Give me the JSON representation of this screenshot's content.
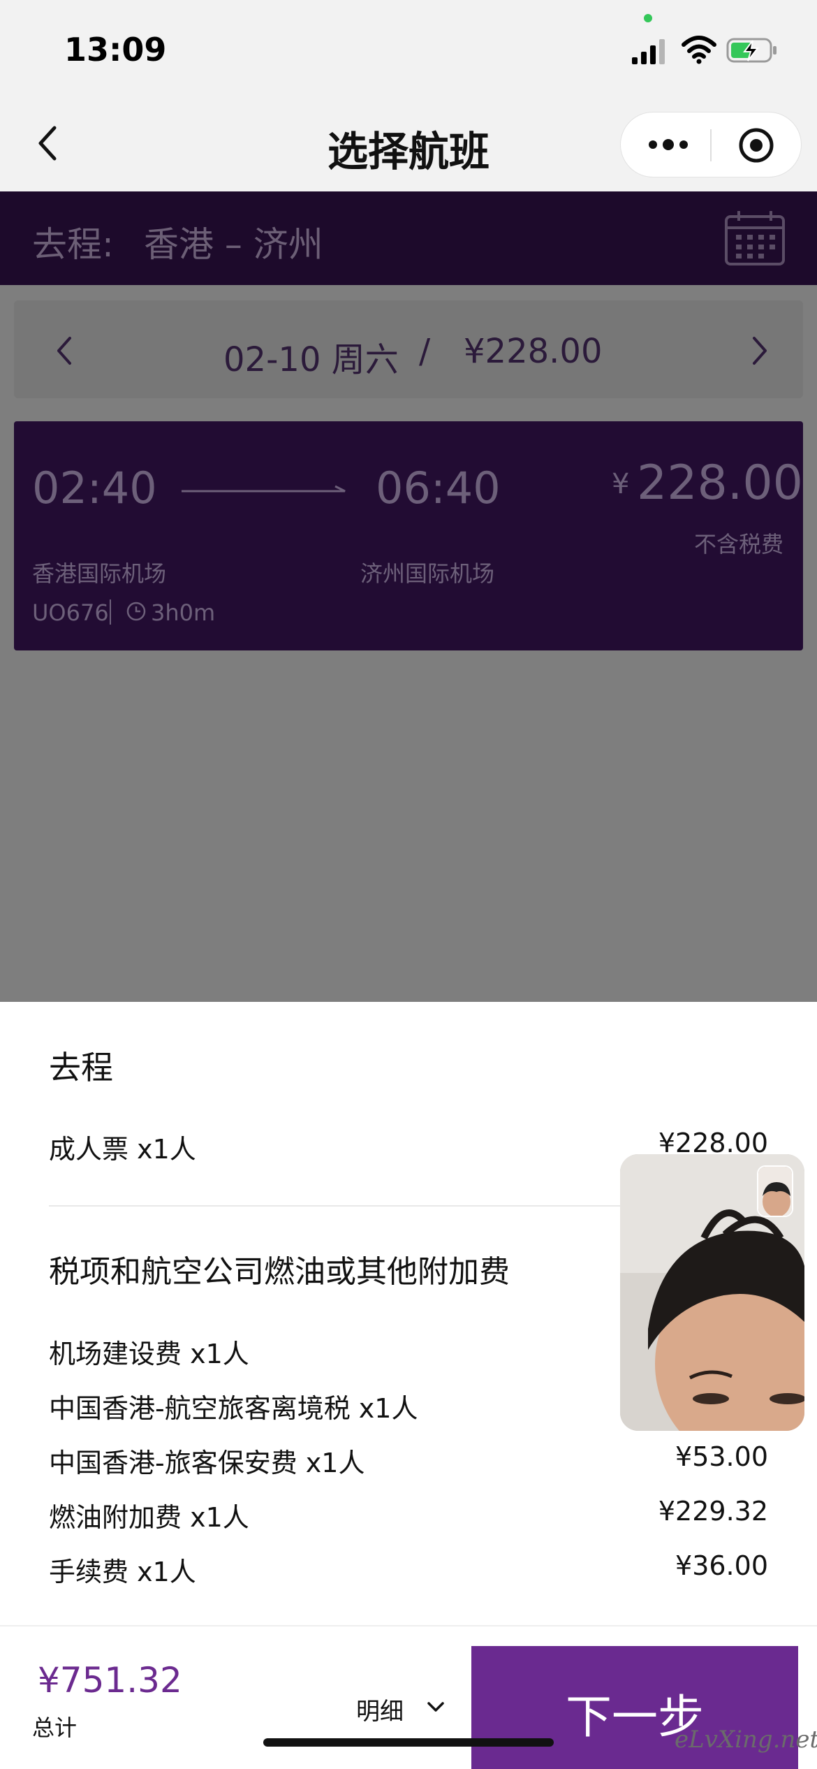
{
  "status_bar": {
    "time": "13:09"
  },
  "nav": {
    "title": "选择航班"
  },
  "route": {
    "label": "去程:",
    "cities": "香港 – 济州"
  },
  "date_selector": {
    "date": "02-10 周六",
    "separator": "/",
    "price": "¥228.00"
  },
  "flight": {
    "departure_time": "02:40",
    "arrival_time": "06:40",
    "price_symbol": "¥",
    "price": "228.00",
    "tax_note": "不含税费",
    "departure_airport": "香港国际机场",
    "arrival_airport": "济州国际机场",
    "flight_no": "UO676",
    "duration": "3h0m"
  },
  "sheet": {
    "title": "去程",
    "adult_ticket": {
      "label": "成人票 x1人",
      "amount": "¥228.00"
    },
    "tax_title": "税项和航空公司燃油或其他附加费",
    "fees": [
      {
        "label": "机场建设费 x1人"
      },
      {
        "label": "中国香港-航空旅客离境税 x1人"
      },
      {
        "label": "中国香港-旅客保安费 x1人",
        "amount": "¥53.00"
      },
      {
        "label": "燃油附加费 x1人",
        "amount": "¥229.32"
      },
      {
        "label": "手续费 x1人",
        "amount": "¥36.00"
      }
    ]
  },
  "bottom": {
    "total_price": "¥751.32",
    "total_label": "总计",
    "detail_label": "明细",
    "next_label": "下一步"
  },
  "watermark": "eLvXing.net",
  "colors": {
    "accent": "#6a2a90",
    "route_bar": "#1d0a2b",
    "price": "#6b2a8f"
  }
}
